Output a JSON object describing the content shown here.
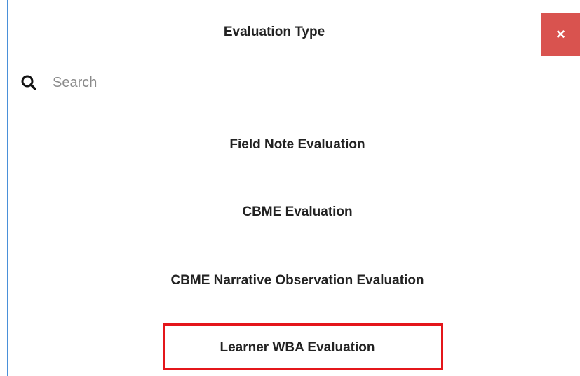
{
  "dialog": {
    "title": "Evaluation Type",
    "close_label": "×"
  },
  "search": {
    "placeholder": "Search",
    "value": ""
  },
  "options": [
    {
      "label": "Field Note Evaluation"
    },
    {
      "label": "CBME Evaluation"
    },
    {
      "label": "CBME Narrative Observation Evaluation"
    },
    {
      "label": "Learner WBA Evaluation"
    }
  ],
  "colors": {
    "close_bg": "#d9534f",
    "highlight": "#e4161b",
    "left_border": "#4a90d9"
  },
  "icons": {
    "search": "search-icon",
    "close": "close-icon"
  }
}
